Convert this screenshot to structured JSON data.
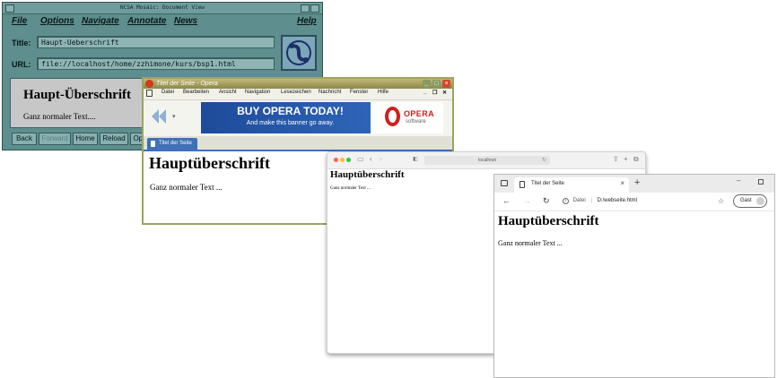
{
  "mosaic": {
    "window_title": "NCSA Mosaic: Document View",
    "menu": [
      "File",
      "Options",
      "Navigate",
      "Annotate",
      "News",
      "Help"
    ],
    "title_label": "Title:",
    "title_value": "Haupt-Ueberschrift",
    "url_label": "URL:",
    "url_value": "file://localhost/home/zzhimone/kurs/bsp1.html",
    "heading": "Haupt-Überschrift",
    "text": "Ganz normaler Text....",
    "buttons": [
      "Back",
      "Forward",
      "Home",
      "Reload",
      "Ope"
    ],
    "colors": {
      "chrome": "#5e8e8e",
      "content_bg": "#c7c7c7"
    },
    "icons": [
      "mosaic-globe-logo-icon"
    ]
  },
  "opera": {
    "window_title": "Titel der Seite - Opera",
    "menu": [
      "Datei",
      "Bearbeiten",
      "Ansicht",
      "Navigation",
      "Lesezeichen",
      "Nachricht",
      "Fenster",
      "Hilfe"
    ],
    "banner": {
      "headline": "BUY OPERA TODAY!",
      "subline": "And make this banner go away.",
      "brand": "OPERA",
      "brand_sub": "software"
    },
    "tab_title": "Titel der Seite",
    "heading": "Hauptüberschrift",
    "text": "Ganz normaler Text ...",
    "colors": {
      "banner": "#1e4b9a",
      "tab": "#3f70b8",
      "brand_red": "#d0201b"
    },
    "icons": [
      "back-arrow-icon",
      "document-icon",
      "minimize-icon",
      "maximize-icon",
      "close-icon"
    ]
  },
  "safari": {
    "address": "localhost",
    "heading": "Hauptüberschrift",
    "text": "Ganz normaler Text ...",
    "colors": {
      "close": "#fe5f57",
      "minimize": "#febc2e",
      "zoom": "#28c840"
    },
    "icons": [
      "sidebar-icon",
      "back-icon",
      "forward-icon",
      "reload-icon",
      "share-icon",
      "new-tab-icon",
      "tabs-overview-icon"
    ]
  },
  "edge": {
    "tab_title": "Titel der Seite",
    "address_scheme": "Datei",
    "address": "D:/webseite.html",
    "profile": "Gast",
    "heading": "Hauptüberschrift",
    "text": "Ganz normaler Text ...",
    "icons": [
      "tab-actions-icon",
      "document-icon",
      "tab-close-icon",
      "new-tab-icon",
      "minimize-icon",
      "maximize-icon",
      "back-icon",
      "forward-icon",
      "refresh-icon",
      "info-icon",
      "favorites-icon",
      "avatar-icon"
    ]
  }
}
